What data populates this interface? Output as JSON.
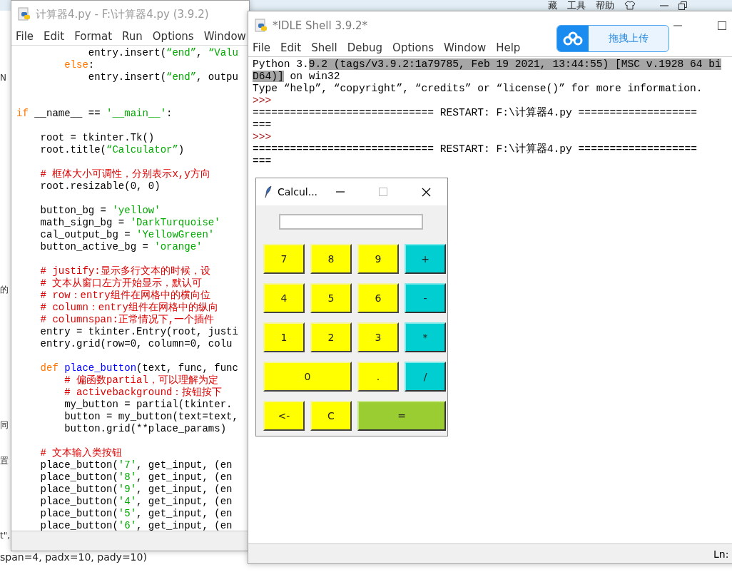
{
  "background_page": {
    "menu": [
      "藏",
      "工具",
      "帮助"
    ],
    "fragments": [
      "N",
      "的",
      "同",
      "置",
      "t\","
    ],
    "bottom_line": "span=4, padx=10, pady=10)"
  },
  "editor": {
    "title": "计算器4.py - F:\\计算器4.py (3.9.2)",
    "menu": [
      "File",
      "Edit",
      "Format",
      "Run",
      "Options",
      "Window"
    ],
    "lines": [
      {
        "kind": "code",
        "segments": [
          {
            "kind": "plain",
            "text": "            entry.insert("
          },
          {
            "kind": "string",
            "text": "“end”"
          },
          {
            "kind": "plain",
            "text": ", "
          },
          {
            "kind": "string",
            "text": "“Valu"
          }
        ]
      },
      {
        "kind": "code",
        "segments": [
          {
            "kind": "keyword",
            "text": "        else"
          },
          {
            "kind": "plain",
            "text": ":"
          }
        ]
      },
      {
        "kind": "code",
        "segments": [
          {
            "kind": "plain",
            "text": "            entry.insert("
          },
          {
            "kind": "string",
            "text": "“end”"
          },
          {
            "kind": "plain",
            "text": ", outpu"
          }
        ]
      },
      {
        "kind": "blank"
      },
      {
        "kind": "blank"
      },
      {
        "kind": "code",
        "segments": [
          {
            "kind": "keyword",
            "text": "if"
          },
          {
            "kind": "plain",
            "text": " __name__ == "
          },
          {
            "kind": "string",
            "text": "'__main__'"
          },
          {
            "kind": "plain",
            "text": ":"
          }
        ]
      },
      {
        "kind": "blank"
      },
      {
        "kind": "code",
        "segments": [
          {
            "kind": "plain",
            "text": "    root = tkinter.Tk()"
          }
        ]
      },
      {
        "kind": "code",
        "segments": [
          {
            "kind": "plain",
            "text": "    root.title("
          },
          {
            "kind": "string",
            "text": "“Calculator”"
          },
          {
            "kind": "plain",
            "text": ")"
          }
        ]
      },
      {
        "kind": "blank"
      },
      {
        "kind": "code",
        "segments": [
          {
            "kind": "comment",
            "text": "    # 框体大小可调性，分别表示x,y方向"
          }
        ]
      },
      {
        "kind": "code",
        "segments": [
          {
            "kind": "plain",
            "text": "    root.resizable(0, 0)"
          }
        ]
      },
      {
        "kind": "blank"
      },
      {
        "kind": "code",
        "segments": [
          {
            "kind": "plain",
            "text": "    button_bg = "
          },
          {
            "kind": "string",
            "text": "'yellow'"
          }
        ]
      },
      {
        "kind": "code",
        "segments": [
          {
            "kind": "plain",
            "text": "    math_sign_bg = "
          },
          {
            "kind": "string",
            "text": "'DarkTurquoise'"
          }
        ]
      },
      {
        "kind": "code",
        "segments": [
          {
            "kind": "plain",
            "text": "    cal_output_bg = "
          },
          {
            "kind": "string",
            "text": "'YellowGreen'"
          }
        ]
      },
      {
        "kind": "code",
        "segments": [
          {
            "kind": "plain",
            "text": "    button_active_bg = "
          },
          {
            "kind": "string",
            "text": "'orange'"
          }
        ]
      },
      {
        "kind": "blank"
      },
      {
        "kind": "code",
        "segments": [
          {
            "kind": "comment",
            "text": "    # justify:显示多行文本的时候，设"
          }
        ]
      },
      {
        "kind": "code",
        "segments": [
          {
            "kind": "comment",
            "text": "    # 文本从窗口左方开始显示，默认可"
          }
        ]
      },
      {
        "kind": "code",
        "segments": [
          {
            "kind": "comment",
            "text": "    # row：entry组件在网格中的横向位"
          }
        ]
      },
      {
        "kind": "code",
        "segments": [
          {
            "kind": "comment",
            "text": "    # column：entry组件在网格中的纵向"
          }
        ]
      },
      {
        "kind": "code",
        "segments": [
          {
            "kind": "comment",
            "text": "    # columnspan:正常情况下,一个插件"
          }
        ]
      },
      {
        "kind": "code",
        "segments": [
          {
            "kind": "plain",
            "text": "    entry = tkinter.Entry(root, justi"
          }
        ]
      },
      {
        "kind": "code",
        "segments": [
          {
            "kind": "plain",
            "text": "    entry.grid(row=0, column=0, colu"
          }
        ]
      },
      {
        "kind": "blank"
      },
      {
        "kind": "code",
        "segments": [
          {
            "kind": "keyword",
            "text": "    def"
          },
          {
            "kind": "definition",
            "text": " place_button"
          },
          {
            "kind": "plain",
            "text": "(text, func, func"
          }
        ]
      },
      {
        "kind": "code",
        "segments": [
          {
            "kind": "comment",
            "text": "        # 偏函数partial，可以理解为定"
          }
        ]
      },
      {
        "kind": "code",
        "segments": [
          {
            "kind": "comment",
            "text": "        # activebackground：按钮按下"
          }
        ]
      },
      {
        "kind": "code",
        "segments": [
          {
            "kind": "plain",
            "text": "        my_button = partial(tkinter."
          }
        ]
      },
      {
        "kind": "code",
        "segments": [
          {
            "kind": "plain",
            "text": "        button = my_button(text=text,"
          }
        ]
      },
      {
        "kind": "code",
        "segments": [
          {
            "kind": "plain",
            "text": "        button.grid(**place_params)"
          }
        ]
      },
      {
        "kind": "blank"
      },
      {
        "kind": "code",
        "segments": [
          {
            "kind": "comment",
            "text": "    # 文本输入类按钮"
          }
        ]
      },
      {
        "kind": "code",
        "segments": [
          {
            "kind": "plain",
            "text": "    place_button("
          },
          {
            "kind": "string",
            "text": "'7'"
          },
          {
            "kind": "plain",
            "text": ", get_input, (en"
          }
        ]
      },
      {
        "kind": "code",
        "segments": [
          {
            "kind": "plain",
            "text": "    place_button("
          },
          {
            "kind": "string",
            "text": "'8'"
          },
          {
            "kind": "plain",
            "text": ", get_input, (en"
          }
        ]
      },
      {
        "kind": "code",
        "segments": [
          {
            "kind": "plain",
            "text": "    place_button("
          },
          {
            "kind": "string",
            "text": "'9'"
          },
          {
            "kind": "plain",
            "text": ", get_input, (en"
          }
        ]
      },
      {
        "kind": "code",
        "segments": [
          {
            "kind": "plain",
            "text": "    place_button("
          },
          {
            "kind": "string",
            "text": "'4'"
          },
          {
            "kind": "plain",
            "text": ", get_input, (en"
          }
        ]
      },
      {
        "kind": "code",
        "segments": [
          {
            "kind": "plain",
            "text": "    place_button("
          },
          {
            "kind": "string",
            "text": "'5'"
          },
          {
            "kind": "plain",
            "text": ", get_input, (en"
          }
        ]
      },
      {
        "kind": "code",
        "segments": [
          {
            "kind": "plain",
            "text": "    place_button("
          },
          {
            "kind": "string",
            "text": "'6'"
          },
          {
            "kind": "plain",
            "text": ", get_input, (en"
          }
        ]
      }
    ]
  },
  "shell": {
    "title": "*IDLE Shell 3.9.2*",
    "menu": [
      "File",
      "Edit",
      "Shell",
      "Debug",
      "Options",
      "Window",
      "Help"
    ],
    "lines": [
      {
        "segments": [
          {
            "kind": "plain",
            "text": "Python 3."
          },
          {
            "kind": "selected",
            "text": "9.2 (tags/v3.9.2:1a79785, Feb 19 2021, 13:44:55) [MSC v.1928 64 bi"
          }
        ]
      },
      {
        "segments": [
          {
            "kind": "selected",
            "text": "D64)]"
          },
          {
            "kind": "plain",
            "text": " on win32"
          }
        ]
      },
      {
        "segments": [
          {
            "kind": "plain",
            "text": "Type “help”, “copyright”, “credits” or “license()” for more information."
          }
        ]
      },
      {
        "segments": [
          {
            "kind": "prompt",
            "text": ">>>"
          }
        ]
      },
      {
        "segments": [
          {
            "kind": "plain",
            "text": "============================= RESTART: F:\\计算器4.py ==================="
          }
        ]
      },
      {
        "segments": [
          {
            "kind": "plain",
            "text": "==="
          }
        ]
      },
      {
        "segments": [
          {
            "kind": "prompt",
            "text": ">>>"
          }
        ]
      },
      {
        "segments": [
          {
            "kind": "plain",
            "text": "============================= RESTART: F:\\计算器4.py ==================="
          }
        ]
      },
      {
        "segments": [
          {
            "kind": "plain",
            "text": "==="
          }
        ]
      }
    ],
    "status": "Ln:"
  },
  "upload_button": {
    "label": "拖拽上传"
  },
  "calculator": {
    "title": "Calcul...",
    "keys": [
      {
        "label": "7",
        "kind": "digit",
        "wide": false
      },
      {
        "label": "8",
        "kind": "digit",
        "wide": false
      },
      {
        "label": "9",
        "kind": "digit",
        "wide": false
      },
      {
        "label": "+",
        "kind": "sign",
        "wide": false
      },
      {
        "label": "4",
        "kind": "digit",
        "wide": false
      },
      {
        "label": "5",
        "kind": "digit",
        "wide": false
      },
      {
        "label": "6",
        "kind": "digit",
        "wide": false
      },
      {
        "label": "-",
        "kind": "sign",
        "wide": false
      },
      {
        "label": "1",
        "kind": "digit",
        "wide": false
      },
      {
        "label": "2",
        "kind": "digit",
        "wide": false
      },
      {
        "label": "3",
        "kind": "digit",
        "wide": false
      },
      {
        "label": "*",
        "kind": "sign",
        "wide": false
      },
      {
        "label": "0",
        "kind": "digit",
        "wide": true
      },
      {
        "label": ".",
        "kind": "digit",
        "wide": false
      },
      {
        "label": "/",
        "kind": "sign",
        "wide": false
      },
      {
        "label": "<-",
        "kind": "digit",
        "wide": false
      },
      {
        "label": "C",
        "kind": "digit",
        "wide": false
      },
      {
        "label": "=",
        "kind": "equals",
        "wide": true
      }
    ]
  }
}
